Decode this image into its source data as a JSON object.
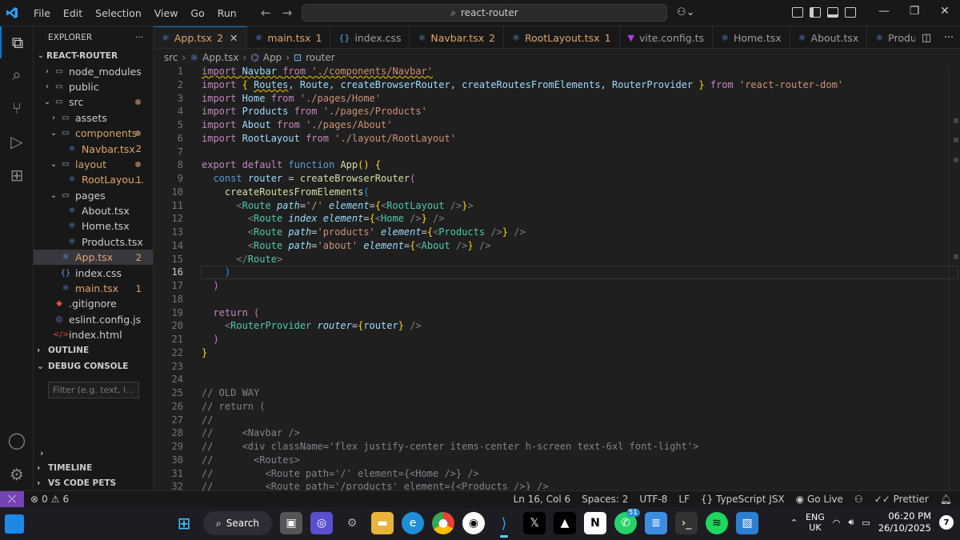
{
  "titlebar": {
    "menu": [
      "File",
      "Edit",
      "Selection",
      "View",
      "Go",
      "Run"
    ],
    "search": "react-router"
  },
  "sidebar": {
    "title": "EXPLORER",
    "root": "REACT-ROUTER",
    "tree": [
      {
        "label": "node_modules",
        "kind": "folder",
        "depth": 1,
        "open": false,
        "color": "#cccccc",
        "badge": "",
        "dot": false
      },
      {
        "label": "public",
        "kind": "folder",
        "depth": 1,
        "open": false,
        "color": "#cccccc",
        "badge": "",
        "dot": false
      },
      {
        "label": "src",
        "kind": "folder",
        "depth": 1,
        "open": true,
        "color": "#cccccc",
        "badge": "",
        "dot": true
      },
      {
        "label": "assets",
        "kind": "folder",
        "depth": 2,
        "open": false,
        "color": "#cccccc",
        "badge": "",
        "dot": false
      },
      {
        "label": "components",
        "kind": "folder",
        "depth": 2,
        "open": true,
        "color": "#d2a46b",
        "badge": "",
        "dot": true
      },
      {
        "label": "Navbar.tsx",
        "kind": "tsx",
        "depth": 3,
        "open": false,
        "color": "#e2a46b",
        "badge": "2",
        "dot": false
      },
      {
        "label": "layout",
        "kind": "folder",
        "depth": 2,
        "open": true,
        "color": "#d2a46b",
        "badge": "",
        "dot": true
      },
      {
        "label": "RootLayou...",
        "kind": "tsx",
        "depth": 3,
        "open": false,
        "color": "#e2a46b",
        "badge": "1",
        "dot": false
      },
      {
        "label": "pages",
        "kind": "folder",
        "depth": 2,
        "open": true,
        "color": "#cccccc",
        "badge": "",
        "dot": false
      },
      {
        "label": "About.tsx",
        "kind": "tsx",
        "depth": 3,
        "open": false,
        "color": "#cccccc",
        "badge": "",
        "dot": false
      },
      {
        "label": "Home.tsx",
        "kind": "tsx",
        "depth": 3,
        "open": false,
        "color": "#cccccc",
        "badge": "",
        "dot": false
      },
      {
        "label": "Products.tsx",
        "kind": "tsx",
        "depth": 3,
        "open": false,
        "color": "#cccccc",
        "badge": "",
        "dot": false
      },
      {
        "label": "App.tsx",
        "kind": "tsx",
        "depth": 2,
        "open": false,
        "color": "#e2a46b",
        "badge": "2",
        "dot": false,
        "selected": true
      },
      {
        "label": "index.css",
        "kind": "css",
        "depth": 2,
        "open": false,
        "color": "#cccccc",
        "badge": "",
        "dot": false
      },
      {
        "label": "main.tsx",
        "kind": "tsx",
        "depth": 2,
        "open": false,
        "color": "#e2a46b",
        "badge": "1",
        "dot": false
      },
      {
        "label": ".gitignore",
        "kind": "git",
        "depth": 1,
        "open": false,
        "color": "#cccccc",
        "badge": "",
        "dot": false
      },
      {
        "label": "eslint.config.js",
        "kind": "js",
        "depth": 1,
        "open": false,
        "color": "#cccccc",
        "badge": "",
        "dot": false
      },
      {
        "label": "index.html",
        "kind": "html",
        "depth": 1,
        "open": false,
        "color": "#cccccc",
        "badge": "",
        "dot": false
      }
    ],
    "outline": "OUTLINE",
    "debug_console": "DEBUG CONSOLE",
    "filter_placeholder": "Filter (e.g. text, l...",
    "timeline": "TIMELINE",
    "vscode_pets": "VS CODE PETS"
  },
  "tabs": [
    {
      "label": "App.tsx",
      "num": "2",
      "icon": "react",
      "active": true,
      "color": "#e2a46b"
    },
    {
      "label": "main.tsx",
      "num": "1",
      "icon": "react",
      "active": false,
      "color": "#e2a46b"
    },
    {
      "label": "index.css",
      "num": "",
      "icon": "css",
      "active": false,
      "color": "#9d9d9d"
    },
    {
      "label": "Navbar.tsx",
      "num": "2",
      "icon": "react",
      "active": false,
      "color": "#e2a46b"
    },
    {
      "label": "RootLayout.tsx",
      "num": "1",
      "icon": "react",
      "active": false,
      "color": "#e2a46b"
    },
    {
      "label": "vite.config.ts",
      "num": "",
      "icon": "vite",
      "active": false,
      "color": "#9d9d9d"
    },
    {
      "label": "Home.tsx",
      "num": "",
      "icon": "react",
      "active": false,
      "color": "#9d9d9d"
    },
    {
      "label": "About.tsx",
      "num": "",
      "icon": "react",
      "active": false,
      "color": "#9d9d9d"
    },
    {
      "label": "Produ",
      "num": "",
      "icon": "react",
      "active": false,
      "color": "#9d9d9d"
    }
  ],
  "breadcrumb": [
    "src",
    "App.tsx",
    "App",
    "router"
  ],
  "editor": {
    "current_line": 16,
    "lines": [
      [
        [
          "import",
          "kw sq"
        ],
        [
          " Navbar ",
          "vr sq"
        ],
        [
          "from",
          "kw sq"
        ],
        [
          " ",
          "sq"
        ],
        [
          "'./components/Navbar'",
          "st sq"
        ]
      ],
      [
        [
          "import",
          "kw"
        ],
        [
          " ",
          ""
        ],
        [
          "{",
          "br1"
        ],
        [
          " ",
          ""
        ],
        [
          "Routes",
          "vr sq"
        ],
        [
          ", Route, createBrowserRouter, createRoutesFromElements, RouterProvider ",
          "vr"
        ],
        [
          "}",
          "br1"
        ],
        [
          " ",
          ""
        ],
        [
          "from",
          "kw"
        ],
        [
          " ",
          ""
        ],
        [
          "'react-router-dom'",
          "st"
        ]
      ],
      [
        [
          "import",
          "kw"
        ],
        [
          " Home ",
          "vr"
        ],
        [
          "from",
          "kw"
        ],
        [
          " ",
          ""
        ],
        [
          "'./pages/Home'",
          "st"
        ]
      ],
      [
        [
          "import",
          "kw"
        ],
        [
          " Products ",
          "vr"
        ],
        [
          "from",
          "kw"
        ],
        [
          " ",
          ""
        ],
        [
          "'./pages/Products'",
          "st"
        ]
      ],
      [
        [
          "import",
          "kw"
        ],
        [
          " About ",
          "vr"
        ],
        [
          "from",
          "kw"
        ],
        [
          " ",
          ""
        ],
        [
          "'./pages/About'",
          "st"
        ]
      ],
      [
        [
          "import",
          "kw"
        ],
        [
          " RootLayout ",
          "vr"
        ],
        [
          "from",
          "kw"
        ],
        [
          " ",
          ""
        ],
        [
          "'./layout/RootLayout'",
          "st"
        ]
      ],
      [],
      [
        [
          "export",
          "kw"
        ],
        [
          " ",
          ""
        ],
        [
          "default",
          "kw"
        ],
        [
          " ",
          ""
        ],
        [
          "function",
          "kb"
        ],
        [
          " ",
          ""
        ],
        [
          "App",
          "fn"
        ],
        [
          "()",
          "br1"
        ],
        [
          " ",
          ""
        ],
        [
          "{",
          "br1"
        ]
      ],
      [
        [
          "  ",
          ""
        ],
        [
          "const",
          "kb"
        ],
        [
          " ",
          ""
        ],
        [
          "router",
          "vr"
        ],
        [
          " = ",
          ""
        ],
        [
          "createBrowserRouter",
          "fn"
        ],
        [
          "(",
          "br2"
        ]
      ],
      [
        [
          "    ",
          ""
        ],
        [
          "createRoutesFromElements",
          "fn"
        ],
        [
          "(",
          "br3"
        ]
      ],
      [
        [
          "      ",
          ""
        ],
        [
          "<",
          "pu"
        ],
        [
          "Route",
          "tg"
        ],
        [
          " ",
          ""
        ],
        [
          "path",
          "at"
        ],
        [
          "=",
          ""
        ],
        [
          "'/'",
          "st"
        ],
        [
          " ",
          ""
        ],
        [
          "element",
          "at"
        ],
        [
          "=",
          ""
        ],
        [
          "{",
          "br1"
        ],
        [
          "<",
          "pu"
        ],
        [
          "RootLayout",
          "tg"
        ],
        [
          " ",
          ""
        ],
        [
          "/>",
          "pu"
        ],
        [
          "}",
          "br1"
        ],
        [
          ">",
          "pu"
        ]
      ],
      [
        [
          "        ",
          ""
        ],
        [
          "<",
          "pu"
        ],
        [
          "Route",
          "tg"
        ],
        [
          " ",
          ""
        ],
        [
          "index",
          "at"
        ],
        [
          " ",
          ""
        ],
        [
          "element",
          "at"
        ],
        [
          "=",
          ""
        ],
        [
          "{",
          "br1"
        ],
        [
          "<",
          "pu"
        ],
        [
          "Home",
          "tg"
        ],
        [
          " ",
          ""
        ],
        [
          "/>",
          "pu"
        ],
        [
          "}",
          "br1"
        ],
        [
          " ",
          ""
        ],
        [
          "/>",
          "pu"
        ]
      ],
      [
        [
          "        ",
          ""
        ],
        [
          "<",
          "pu"
        ],
        [
          "Route",
          "tg"
        ],
        [
          " ",
          ""
        ],
        [
          "path",
          "at"
        ],
        [
          "=",
          ""
        ],
        [
          "'products'",
          "st"
        ],
        [
          " ",
          ""
        ],
        [
          "element",
          "at"
        ],
        [
          "=",
          ""
        ],
        [
          "{",
          "br1"
        ],
        [
          "<",
          "pu"
        ],
        [
          "Products",
          "tg"
        ],
        [
          " ",
          ""
        ],
        [
          "/>",
          "pu"
        ],
        [
          "}",
          "br1"
        ],
        [
          " ",
          ""
        ],
        [
          "/>",
          "pu"
        ]
      ],
      [
        [
          "        ",
          ""
        ],
        [
          "<",
          "pu"
        ],
        [
          "Route",
          "tg"
        ],
        [
          " ",
          ""
        ],
        [
          "path",
          "at"
        ],
        [
          "=",
          ""
        ],
        [
          "'about'",
          "st"
        ],
        [
          " ",
          ""
        ],
        [
          "element",
          "at"
        ],
        [
          "=",
          ""
        ],
        [
          "{",
          "br1"
        ],
        [
          "<",
          "pu"
        ],
        [
          "About",
          "tg"
        ],
        [
          " ",
          ""
        ],
        [
          "/>",
          "pu"
        ],
        [
          "}",
          "br1"
        ],
        [
          " ",
          ""
        ],
        [
          "/>",
          "pu"
        ]
      ],
      [
        [
          "      ",
          ""
        ],
        [
          "</",
          "pu"
        ],
        [
          "Route",
          "tg"
        ],
        [
          ">",
          "pu"
        ]
      ],
      [
        [
          "    ",
          ""
        ],
        [
          ")",
          "br3"
        ]
      ],
      [
        [
          "  ",
          ""
        ],
        [
          ")",
          "br2"
        ]
      ],
      [],
      [
        [
          "  ",
          ""
        ],
        [
          "return",
          "kw"
        ],
        [
          " ",
          ""
        ],
        [
          "(",
          "br2"
        ]
      ],
      [
        [
          "    ",
          ""
        ],
        [
          "<",
          "pu"
        ],
        [
          "RouterProvider",
          "tg"
        ],
        [
          " ",
          ""
        ],
        [
          "router",
          "at"
        ],
        [
          "=",
          ""
        ],
        [
          "{",
          "br1"
        ],
        [
          "router",
          "vr"
        ],
        [
          "}",
          "br1"
        ],
        [
          " ",
          ""
        ],
        [
          "/>",
          "pu"
        ]
      ],
      [
        [
          "  ",
          ""
        ],
        [
          ")",
          "br2"
        ]
      ],
      [
        [
          "}",
          "br1"
        ]
      ],
      [],
      [],
      [
        [
          "// OLD WAY",
          "cmg"
        ]
      ],
      [
        [
          "// return (",
          "cmg"
        ]
      ],
      [
        [
          "//",
          "cmg"
        ]
      ],
      [
        [
          "//     <Navbar />",
          "cmg"
        ]
      ],
      [
        [
          "//     <div className='flex justify-center items-center h-screen text-6xl font-light'>",
          "cmg"
        ]
      ],
      [
        [
          "//       <Routes>",
          "cmg"
        ]
      ],
      [
        [
          "//         <Route path='/' element={<Home />} />",
          "cmg"
        ]
      ],
      [
        [
          "//         <Route path='/products' element={<Products />} />",
          "cmg"
        ]
      ]
    ]
  },
  "statusbar": {
    "errors": "0",
    "warnings": "6",
    "position": "Ln 16, Col 6",
    "spaces": "Spaces: 2",
    "encoding": "UTF-8",
    "eol": "LF",
    "language": "TypeScript JSX",
    "golive": "Go Live",
    "prettier": "Prettier"
  },
  "taskbar": {
    "search": "Search",
    "whatsapp_badge": "51",
    "lang_top": "ENG",
    "lang_bottom": "UK",
    "time": "06:20 PM",
    "date": "26/10/2025",
    "notifications": "7"
  }
}
